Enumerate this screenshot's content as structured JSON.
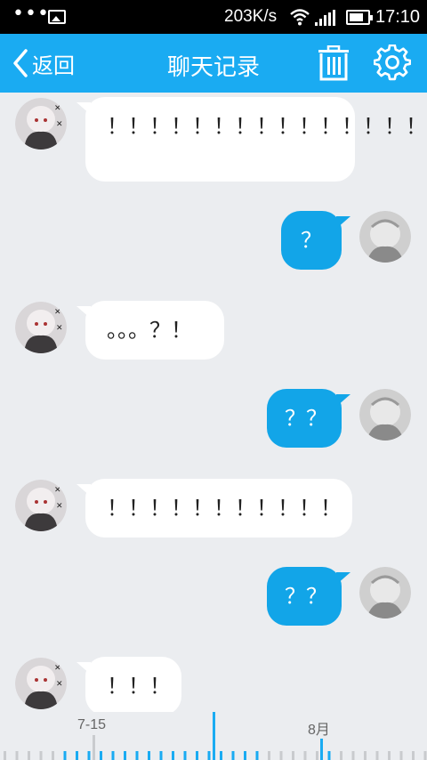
{
  "status_bar": {
    "dots": "•••",
    "speed": "203K/s",
    "time": "17:10",
    "icons": [
      "image-icon",
      "wifi-icon",
      "signal-icon",
      "battery-icon"
    ]
  },
  "header": {
    "back_label": "返回",
    "title": "聊天记录",
    "icons": [
      "chevron-left-icon",
      "trash-icon",
      "gear-icon"
    ],
    "color": "#1aabf2"
  },
  "messages": [
    {
      "side": "in",
      "text": "！！！！！！！！！！！！！！！！"
    },
    {
      "side": "out",
      "text": "？"
    },
    {
      "side": "in",
      "text": "。。。？！"
    },
    {
      "side": "out",
      "text": "？？"
    },
    {
      "side": "in",
      "text": "！！！！！！！！！！！"
    },
    {
      "side": "out",
      "text": "？？"
    },
    {
      "side": "in",
      "text": "！！！"
    }
  ],
  "timeline": {
    "labels": [
      "7-15",
      "8月"
    ],
    "accent": "#1aabf2"
  }
}
